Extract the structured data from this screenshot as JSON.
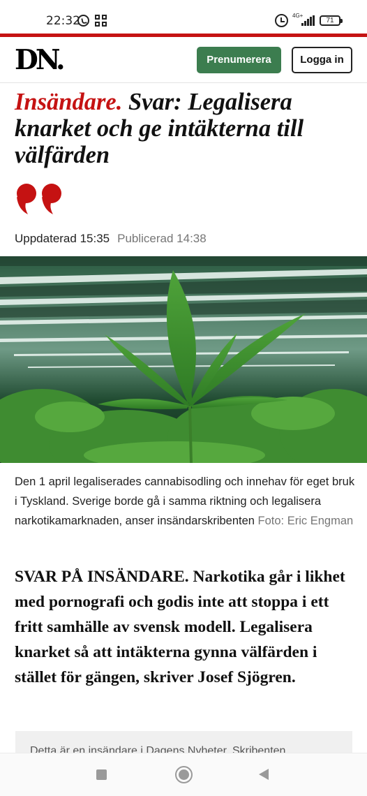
{
  "status": {
    "time": "22:32",
    "network": "4G+",
    "battery": "71"
  },
  "header": {
    "logo": "DN.",
    "subscribe_label": "Prenumerera",
    "login_label": "Logga in"
  },
  "article": {
    "kicker": "Insändare.",
    "headline": " Svar: Legalisera knarket och ge intäkterna till välfärden",
    "updated": "Uppdaterad 15:35",
    "published": "Publicerad 14:38",
    "image_caption": "Den 1 april legaliserades cannabisodling och innehav för eget bruk i Tyskland. Sverige borde gå i samma riktning och legalisera narkotikamarknaden, anser insändarskribenten ",
    "photo_credit": "Foto: Eric Engman",
    "lead": "SVAR PÅ INSÄNDARE. Narkotika går i likhet med pornografi och godis inte att stoppa i ett fritt samhälle av svensk modell. Legalisera knarket så att intäkterna gynna välfärden i stället för gängen, skriver Josef Sjögren.",
    "notice": "Detta är en insändare i Dagens Nyheter. Skribenten"
  },
  "colors": {
    "accent_red": "#c51212",
    "subscribe_green": "#3c7d4f"
  },
  "icons": [
    "whatsapp-icon",
    "app-grid-icon",
    "alarm-icon",
    "signal-icon",
    "battery-icon",
    "quote-icon",
    "recent-apps-icon",
    "home-icon",
    "back-icon"
  ]
}
